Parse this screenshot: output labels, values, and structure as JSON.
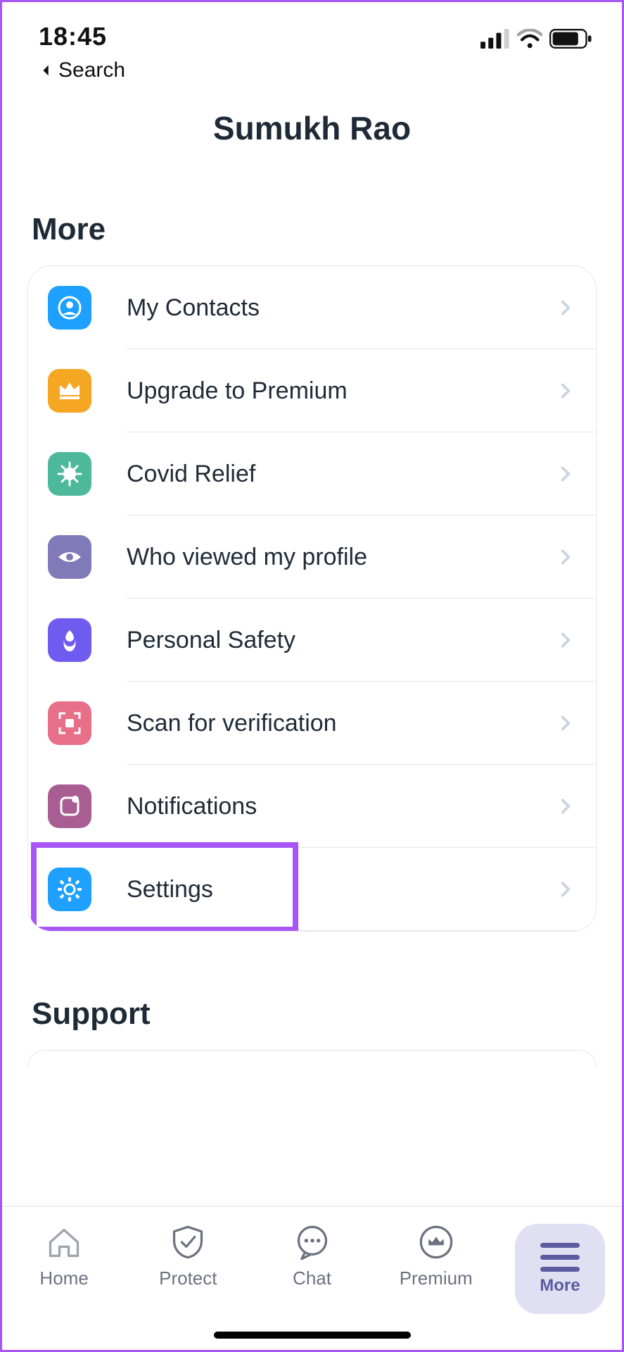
{
  "status": {
    "time": "18:45",
    "back_label": "Search"
  },
  "header": {
    "title": "Sumukh Rao"
  },
  "sections": {
    "more_title": "More",
    "support_title": "Support"
  },
  "more_items": [
    {
      "label": "My Contacts",
      "icon": "person-icon",
      "color": "#1ea0ff"
    },
    {
      "label": "Upgrade to Premium",
      "icon": "crown-icon",
      "color": "#f5a623"
    },
    {
      "label": "Covid Relief",
      "icon": "virus-icon",
      "color": "#4db89a"
    },
    {
      "label": "Who viewed my profile",
      "icon": "eye-icon",
      "color": "#807ab8"
    },
    {
      "label": "Personal Safety",
      "icon": "tulip-icon",
      "color": "#6f5bf0"
    },
    {
      "label": "Scan for verification",
      "icon": "qr-icon",
      "color": "#e86f8a"
    },
    {
      "label": "Notifications",
      "icon": "bell-icon",
      "color": "#a85e93"
    },
    {
      "label": "Settings",
      "icon": "gear-icon",
      "color": "#1ea0ff"
    }
  ],
  "tabs": {
    "home": "Home",
    "protect": "Protect",
    "chat": "Chat",
    "premium": "Premium",
    "more": "More"
  },
  "highlighted_item_index": 7
}
